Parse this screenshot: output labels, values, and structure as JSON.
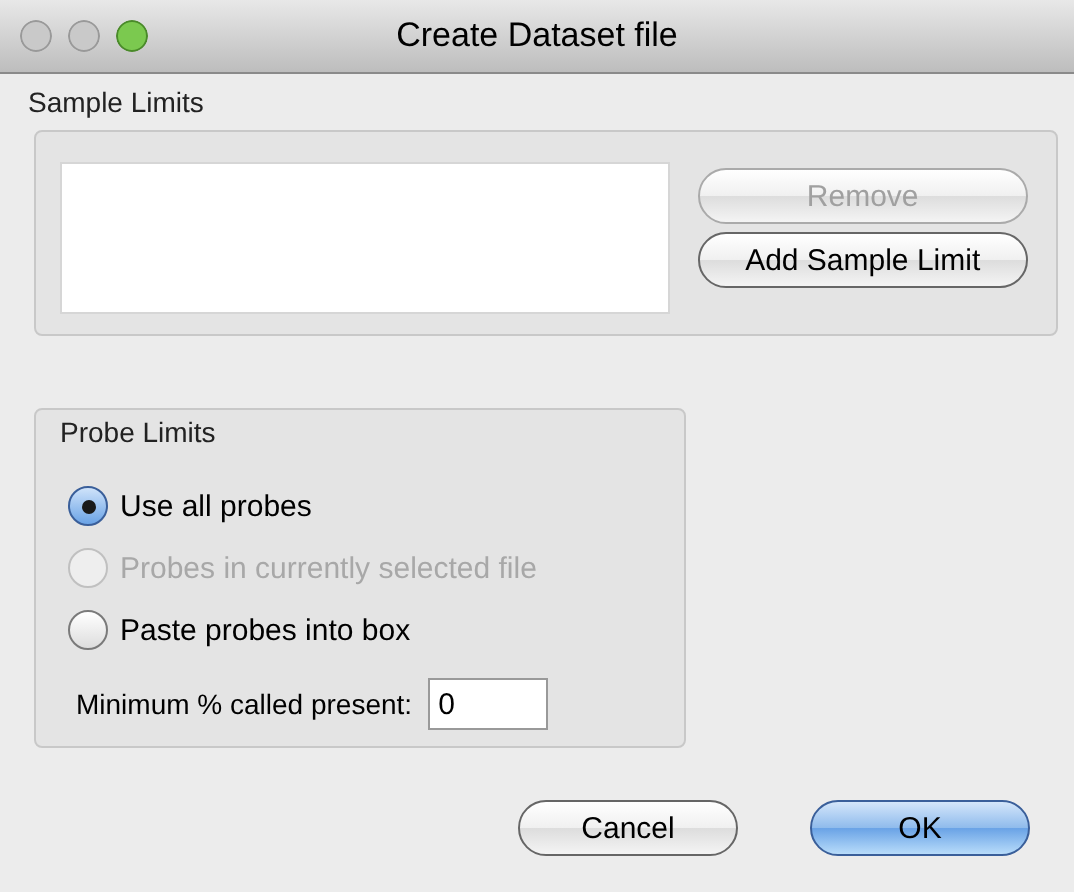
{
  "window": {
    "title": "Create Dataset file"
  },
  "sample_limits": {
    "label": "Sample Limits",
    "buttons": [
      {
        "label": "Remove",
        "disabled": true
      },
      {
        "label": "Add Sample Limit",
        "disabled": false
      }
    ]
  },
  "probe_limits": {
    "label": "Probe Limits",
    "options": [
      {
        "label": "Use all probes",
        "selected": true,
        "disabled": false
      },
      {
        "label": "Probes in currently selected file",
        "selected": false,
        "disabled": true
      },
      {
        "label": "Paste probes into box",
        "selected": false,
        "disabled": false
      }
    ],
    "minimum": {
      "label": "Minimum % called present:",
      "value": "0"
    }
  },
  "buttons": [
    {
      "label": "Cancel",
      "kind": "normal"
    },
    {
      "label": "OK",
      "kind": "default"
    }
  ]
}
